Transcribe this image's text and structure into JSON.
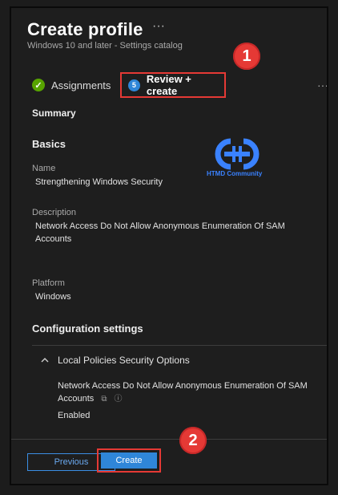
{
  "header": {
    "title": "Create profile",
    "title_more": "···",
    "subtitle": "Windows 10 and later - Settings catalog"
  },
  "tabs": [
    {
      "label": "Assignments",
      "state": "completed",
      "icon": "check-icon"
    },
    {
      "label": "Review + create",
      "state": "active",
      "step": "5"
    }
  ],
  "tabs_more": "···",
  "summary": {
    "heading": "Summary",
    "basics": {
      "heading": "Basics",
      "name_label": "Name",
      "name_value": "Strengthening Windows Security",
      "description_label": "Description",
      "description_value": "Network Access Do Not Allow Anonymous Enumeration Of SAM Accounts",
      "platform_label": "Platform",
      "platform_value": "Windows"
    },
    "configuration": {
      "heading": "Configuration settings",
      "section_label": "Local Policies Security Options",
      "setting_name": "Network Access Do Not Allow Anonymous Enumeration Of SAM Accounts",
      "setting_value": "Enabled"
    }
  },
  "footer": {
    "previous_label": "Previous",
    "create_label": "Create"
  },
  "annotations": {
    "badge1": "1",
    "badge2": "2",
    "logo_text": "HTMD Community"
  },
  "colors": {
    "accent": "#2f86d8",
    "highlight": "#e53935",
    "success": "#57a300"
  }
}
